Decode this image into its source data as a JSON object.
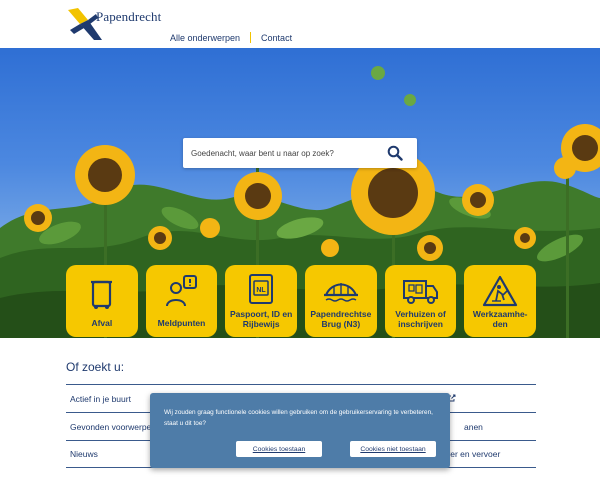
{
  "header": {
    "logo_text": "Papendrecht",
    "nav": [
      {
        "label": "Alle onderwerpen"
      },
      {
        "label": "Contact"
      }
    ]
  },
  "search": {
    "placeholder": "Goedenacht, waar bent u naar op zoek?"
  },
  "tiles": [
    {
      "label": "Afval",
      "icon": "trash-bin-icon"
    },
    {
      "label": "Meldpunten",
      "icon": "person-report-icon"
    },
    {
      "label": "Paspoort, ID en Rijbewijs",
      "icon": "passport-icon",
      "icon_text": "NL"
    },
    {
      "label": "Papendrechtse Brug (N3)",
      "icon": "bridge-icon"
    },
    {
      "label": "Verhuizen of inschrijven",
      "icon": "moving-truck-icon"
    },
    {
      "label": "Werkzaamhe-den",
      "icon": "roadwork-icon"
    }
  ],
  "alternatives": {
    "title": "Of zoekt u:",
    "rows": [
      {
        "left": "Actief in je buurt",
        "right": ""
      },
      {
        "left": "Gevonden voorwerpen",
        "right": "anen"
      },
      {
        "left": "Nieuws",
        "right": "ver en vervoer"
      }
    ]
  },
  "cookie": {
    "text": "Wij zouden graag functionele cookies willen gebruiken om de gebruikerservaring te verbeteren, staat u dit toe?",
    "accept_label": "Cookies toestaan",
    "decline_label": "Cookies niet toestaan"
  },
  "colors": {
    "brand_blue": "#1f3a6e",
    "tile_yellow": "#f6c800",
    "cookie_bg": "#4e7ca8"
  }
}
